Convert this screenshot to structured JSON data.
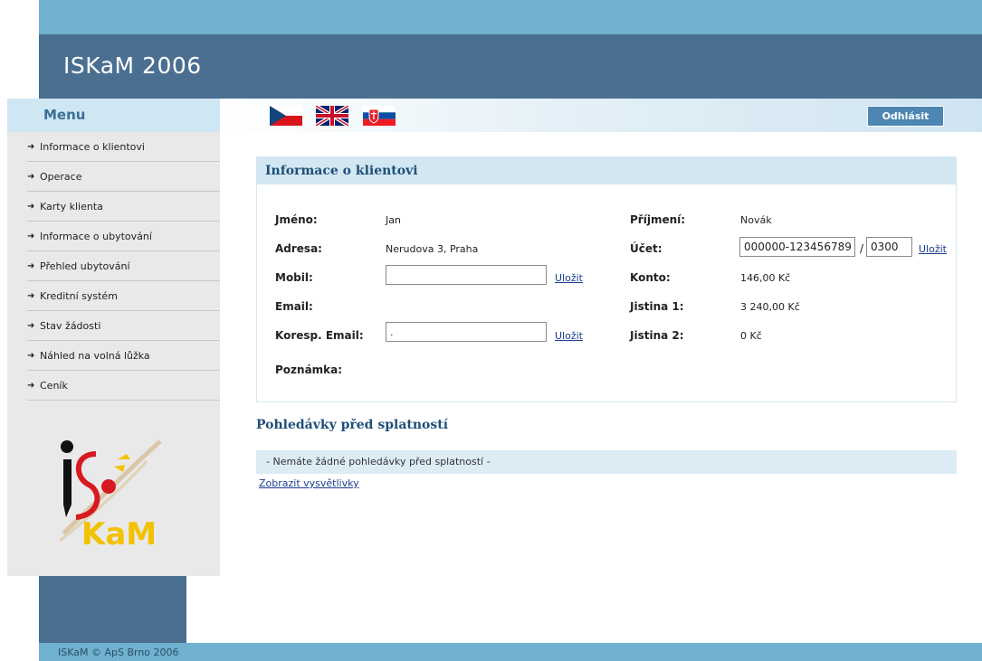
{
  "header": {
    "title": "ISKaM 2006"
  },
  "menu": {
    "title": "Menu",
    "items": [
      {
        "label": "Informace o klientovi"
      },
      {
        "label": "Operace"
      },
      {
        "label": "Karty klienta"
      },
      {
        "label": "Informace o ubytování"
      },
      {
        "label": "Přehled ubytování"
      },
      {
        "label": "Kreditní systém"
      },
      {
        "label": "Stav žádosti"
      },
      {
        "label": "Náhled na volná lůžka"
      },
      {
        "label": "Ceník"
      }
    ]
  },
  "topbar": {
    "logout_label": "Odhlásit"
  },
  "client": {
    "title": "Informace o klientovi",
    "first_name_label": "Jméno:",
    "first_name": "Jan",
    "address_label": "Adresa:",
    "address": "Nerudova 3, Praha",
    "mobile_label": "Mobil:",
    "mobile_value": "",
    "mobile_save": "Uložit",
    "email_label": "Email:",
    "email_value": "",
    "corr_email_label": "Koresp. Email:",
    "corr_email_value": ".",
    "corr_email_save": "Uložit",
    "note_label": "Poznámka:",
    "surname_label": "Příjmení:",
    "surname": "Novák",
    "account_label": "Účet:",
    "account_number": "000000-123456789",
    "account_separator": "/",
    "bank_code": "0300",
    "account_save": "Uložit",
    "balance_label": "Konto:",
    "balance": "146,00 Kč",
    "deposit1_label": "Jistina 1:",
    "deposit1": "3 240,00 Kč",
    "deposit2_label": "Jistina 2:",
    "deposit2": "0 Kč"
  },
  "receivables": {
    "title": "Pohledávky před splatností",
    "empty_text": "- Nemáte žádné pohledávky před splatností -",
    "explain_link": "Zobrazit vysvětlivky"
  },
  "footer": {
    "text": "ISKaM © ApS Brno 2006"
  },
  "colors": {
    "header_light": "#6fb1cf",
    "header_dark": "#4a6f91",
    "menu_title": "#3c6f95",
    "panel_head": "#d3e7f3",
    "link": "#1a3d8f"
  },
  "icons": {
    "flags": [
      "flag-cz-icon",
      "flag-gb-icon",
      "flag-sk-icon"
    ],
    "menu_arrow": "arrow-right-icon"
  }
}
